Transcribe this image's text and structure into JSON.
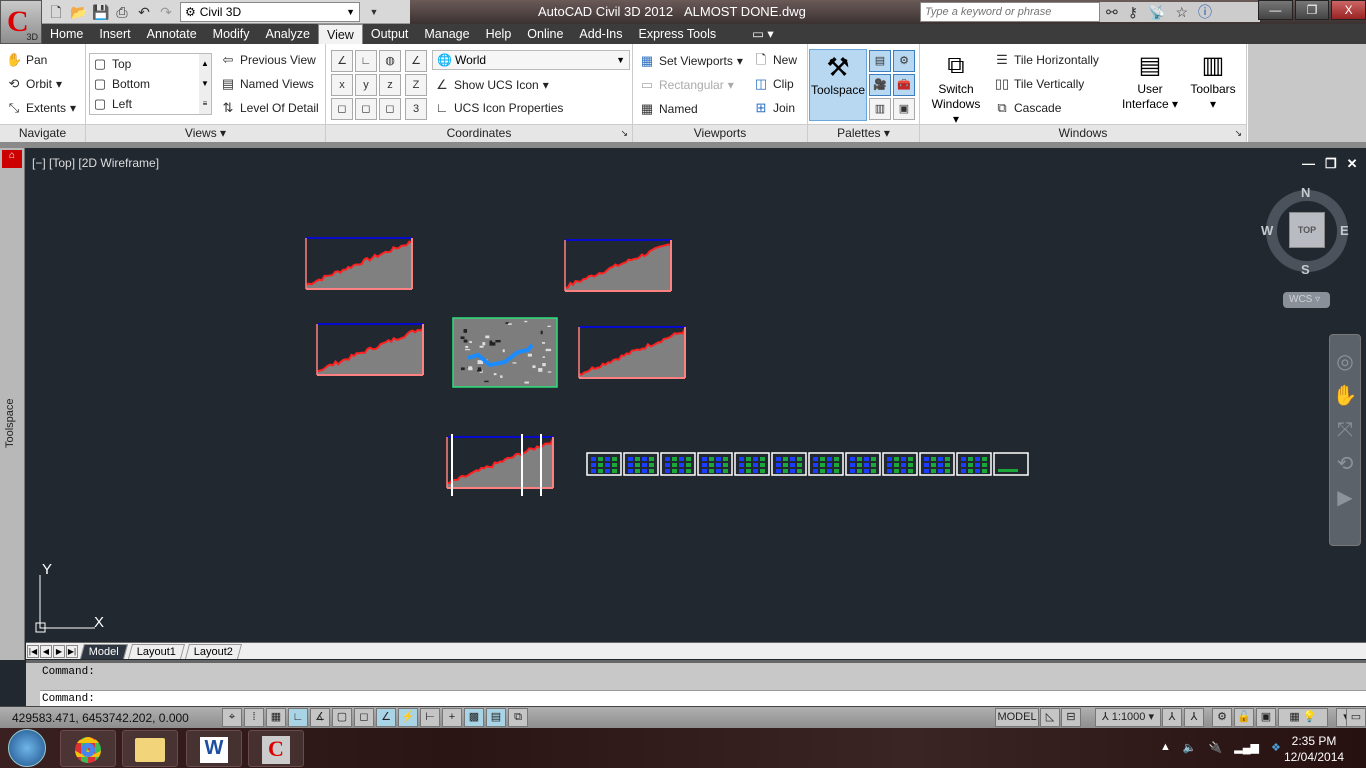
{
  "app": {
    "button_label": "3D",
    "title": "AutoCAD Civil 3D 2012",
    "filename": "ALMOST DONE.dwg",
    "workspace": "Civil 3D",
    "search_placeholder": "Type a keyword or phrase"
  },
  "qat": {
    "icons": [
      "new-icon",
      "open-icon",
      "save-icon",
      "print-icon",
      "undo-icon",
      "redo-icon"
    ]
  },
  "tabs": [
    "Home",
    "Insert",
    "Annotate",
    "Modify",
    "Analyze",
    "View",
    "Output",
    "Manage",
    "Help",
    "Online",
    "Add-Ins",
    "Express Tools"
  ],
  "active_tab": "View",
  "ribbon": {
    "navigate": {
      "title": "Navigate",
      "items": [
        "Pan",
        "Orbit",
        "Extents"
      ]
    },
    "views": {
      "title": "Views",
      "list": [
        "Top",
        "Bottom",
        "Left"
      ],
      "items": [
        "Previous View",
        "Named Views",
        "Level Of Detail"
      ]
    },
    "coordinates": {
      "title": "Coordinates",
      "ucs": "World",
      "items": [
        "Show UCS Icon",
        "UCS Icon Properties"
      ]
    },
    "viewports": {
      "title": "Viewports",
      "items": [
        "Set Viewports",
        "Rectangular",
        "Named",
        "New",
        "Clip",
        "Join"
      ]
    },
    "palettes": {
      "title": "Palettes",
      "toolspace": "Toolspace"
    },
    "windows": {
      "title": "Windows",
      "switch": "Switch Windows",
      "items": [
        "Tile Horizontally",
        "Tile Vertically",
        "Cascade"
      ],
      "ui": "User Interface",
      "toolbars": "Toolbars"
    }
  },
  "toolspace_label": "Toolspace",
  "viewport": {
    "label": "[−] [Top] [2D Wireframe]",
    "viewcube": {
      "n": "N",
      "s": "S",
      "e": "E",
      "w": "W",
      "face": "TOP",
      "wcs": "WCS"
    },
    "ucs": {
      "x": "X",
      "y": "Y"
    }
  },
  "layout_tabs": [
    "Model",
    "Layout1",
    "Layout2"
  ],
  "command": {
    "history": "Command:",
    "prompt": "Command:"
  },
  "status": {
    "coords": "429583.471, 6453742.202, 0.000",
    "model": "MODEL",
    "scale": "1:1000"
  },
  "clock": {
    "time": "2:35 PM",
    "date": "12/04/2014"
  },
  "colors": {
    "canvas": "#212830",
    "profile_fill": "#808080",
    "profile_line": "#ff2020",
    "frame_blue": "#0000ff",
    "frame_pink": "#ff8080",
    "ribbon_active": "#b8d8f2"
  }
}
